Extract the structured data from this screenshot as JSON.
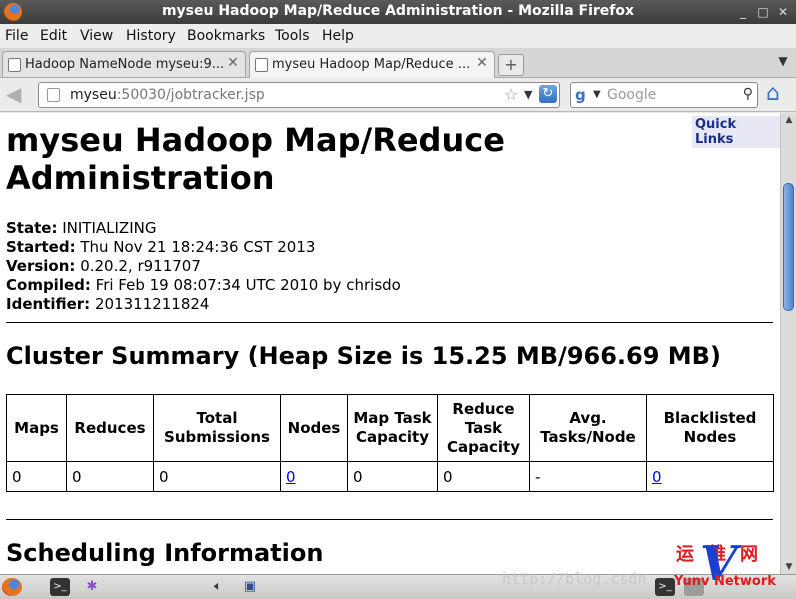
{
  "window": {
    "title": "myseu Hadoop Map/Reduce Administration - Mozilla Firefox",
    "controls": [
      "_",
      "□",
      "✕"
    ]
  },
  "menu": [
    {
      "label": "File"
    },
    {
      "label": "Edit"
    },
    {
      "label": "View"
    },
    {
      "label": "History"
    },
    {
      "label": "Bookmarks"
    },
    {
      "label": "Tools"
    },
    {
      "label": "Help"
    }
  ],
  "tabs": [
    {
      "label": "Hadoop NameNode myseu:9..."
    },
    {
      "label": "myseu Hadoop Map/Reduce ..."
    }
  ],
  "nav": {
    "url_host": "myseu",
    "url_path": ":50030/jobtracker.jsp",
    "search_placeholder": "Google"
  },
  "page": {
    "quick_links": "Quick Links",
    "title": "myseu Hadoop Map/Reduce Administration",
    "info": [
      {
        "label": "State:",
        "value": "INITIALIZING"
      },
      {
        "label": "Started:",
        "value": "Thu Nov 21 18:24:36 CST 2013"
      },
      {
        "label": "Version:",
        "value": "0.20.2, r911707"
      },
      {
        "label": "Compiled:",
        "value": "Fri Feb 19 08:07:34 UTC 2010 by chrisdo"
      },
      {
        "label": "Identifier:",
        "value": "201311211824"
      }
    ],
    "cluster_title": "Cluster Summary (Heap Size is 15.25 MB/966.69 MB)",
    "summary": {
      "headers": [
        "Maps",
        "Reduces",
        "Total Submissions",
        "Nodes",
        "Map Task Capacity",
        "Reduce Task Capacity",
        "Avg. Tasks/Node",
        "Blacklisted Nodes"
      ],
      "row": [
        "0",
        "0",
        "0",
        "0",
        "0",
        "0",
        "-",
        "0"
      ]
    },
    "scheduling_title": "Scheduling Information"
  },
  "watermark": {
    "url": "http://blog.csdn",
    "logo_cn": "运维网",
    "logo_v": "V",
    "logo_en": "Yunv Network"
  }
}
